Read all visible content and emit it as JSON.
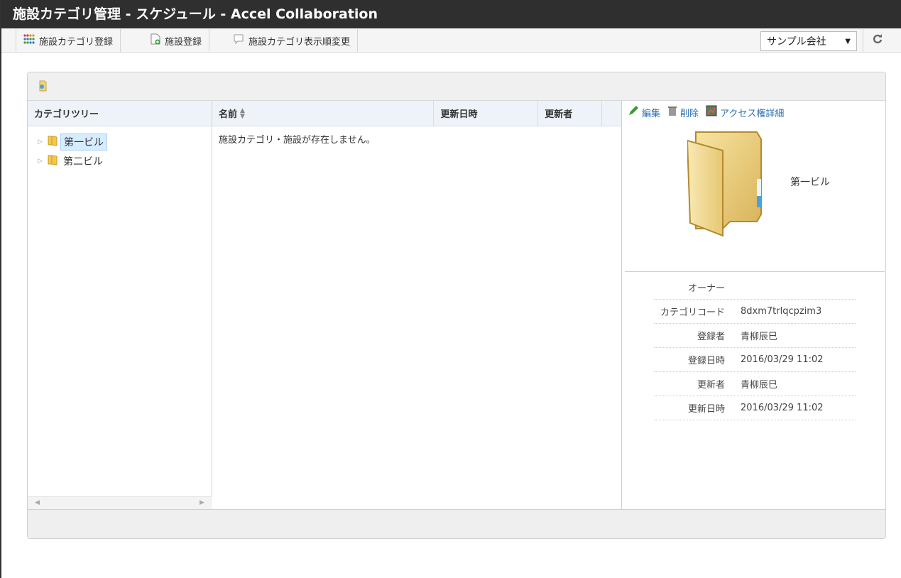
{
  "window": {
    "title": "施設カテゴリ管理 - スケジュール - Accel Collaboration"
  },
  "toolbar": {
    "buttons": [
      {
        "label": "施設カテゴリ登録",
        "icon": "grid-dots-icon"
      },
      {
        "label": "施設登録",
        "icon": "add-document-icon"
      },
      {
        "label": "施設カテゴリ表示順変更",
        "icon": "speech-bubble-icon"
      }
    ],
    "company_select": "サンプル会社",
    "refresh_icon": "refresh-icon"
  },
  "tree": {
    "header": "カテゴリツリー",
    "items": [
      {
        "label": "第一ビル",
        "selected": true
      },
      {
        "label": "第二ビル",
        "selected": false
      }
    ]
  },
  "list": {
    "headers": {
      "name": "名前",
      "updated_at": "更新日時",
      "updated_by": "更新者"
    },
    "sort_icon": "sort-icon",
    "empty_message": "施設カテゴリ・施設が存在しません。"
  },
  "detail": {
    "actions": {
      "edit": "編集",
      "delete": "削除",
      "access": "アクセス権詳細"
    },
    "name": "第一ビル",
    "properties": [
      {
        "key": "オーナー",
        "value": ""
      },
      {
        "key": "カテゴリコード",
        "value": "8dxm7trlqcpzim3"
      },
      {
        "key": "登録者",
        "value": "青柳辰巳"
      },
      {
        "key": "登録日時",
        "value": "2016/03/29 11:02"
      },
      {
        "key": "更新者",
        "value": "青柳辰巳"
      },
      {
        "key": "更新日時",
        "value": "2016/03/29 11:02"
      }
    ]
  }
}
